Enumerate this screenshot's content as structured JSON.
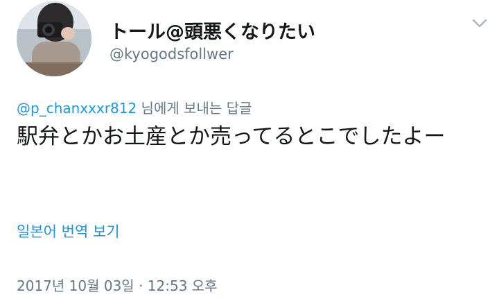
{
  "profile": {
    "display_name": "トール@頭悪くなりたい",
    "handle": "@kyogodsfollwer"
  },
  "reply": {
    "mention": "@p_chanxxxr812",
    "suffix": " 님에게 보내는 답글"
  },
  "tweet": {
    "text": "駅弁とかお土産とか売ってるとこでしたよー"
  },
  "actions": {
    "translate_label": "일본어 번역 보기",
    "menu_icon": "chevron-down-icon"
  },
  "meta": {
    "timestamp": "2017년 10월 03일 · 12:53 오후"
  },
  "colors": {
    "link": "#1b95e0",
    "secondary_text": "#657786",
    "primary_text": "#14171a"
  }
}
